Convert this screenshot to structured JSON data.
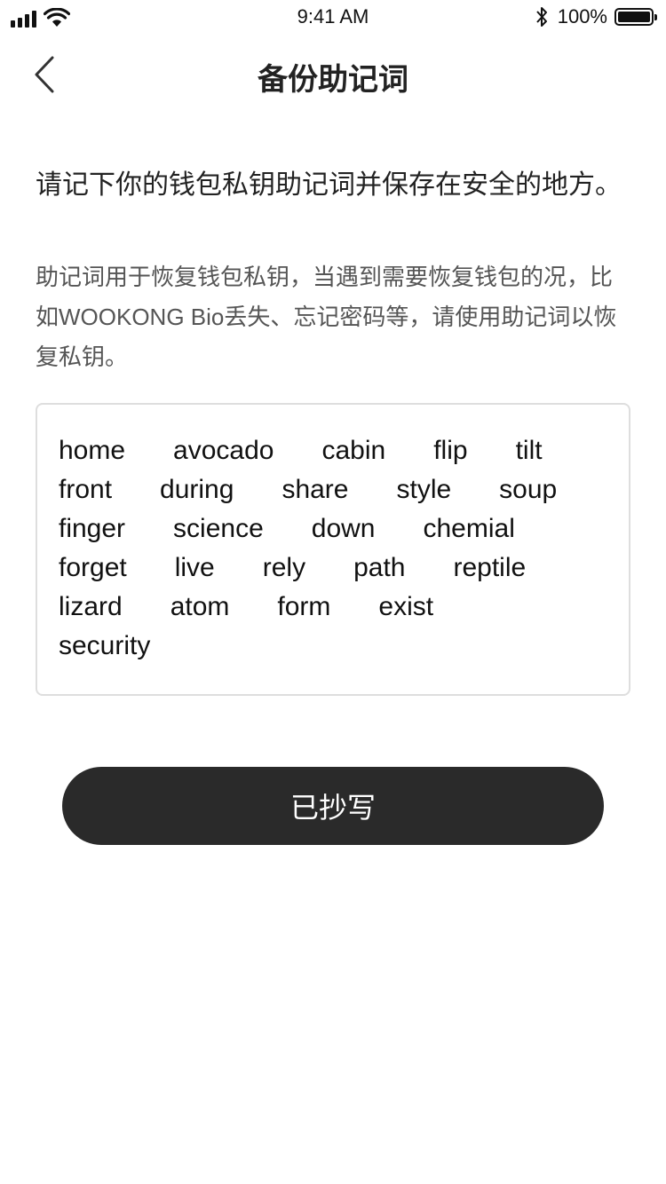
{
  "status_bar": {
    "time": "9:41 AM",
    "battery_percent": "100%",
    "icons": [
      "signal-icon",
      "wifi-icon",
      "bluetooth-icon",
      "battery-icon"
    ]
  },
  "nav": {
    "title": "备份助记词",
    "back_icon": "chevron-left-icon"
  },
  "headline": "请记下你的钱包私钥助记词并保存在安全的地方。",
  "description": "助记词用于恢复钱包私钥，当遇到需要恢复钱包的况，比如WOOKONG Bio丢失、忘记密码等，请使用助记词以恢复私钥。",
  "mnemonic": {
    "words": [
      "home",
      "avocado",
      "cabin",
      "flip",
      "tilt",
      "front",
      "during",
      "share",
      "style",
      "soup",
      "finger",
      "science",
      "down",
      "chemial",
      "forget",
      "live",
      "rely",
      "path",
      "reptile",
      "lizard",
      "atom",
      "form",
      "exist",
      "security"
    ]
  },
  "confirm_button": {
    "label": "已抄写"
  },
  "colors": {
    "button_bg": "#2a2a2a",
    "button_text": "#ffffff",
    "box_border": "#dedede",
    "text_primary": "#222222",
    "text_secondary": "#555555"
  }
}
